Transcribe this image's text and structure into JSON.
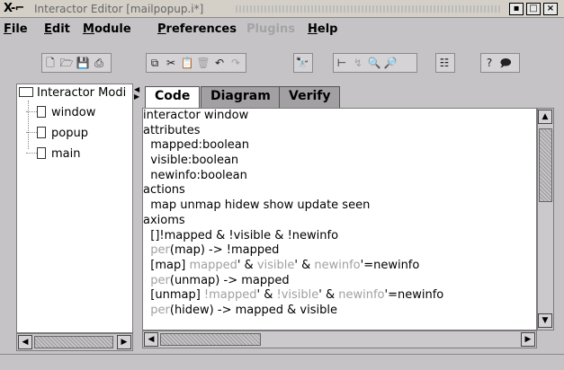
{
  "window": {
    "title": "Interactor Editor [mailpopup.i*]",
    "logo": "X-⌐"
  },
  "menu": [
    {
      "label": "File",
      "enabled": true
    },
    {
      "label": "Edit",
      "enabled": true
    },
    {
      "label": "Module",
      "enabled": true
    },
    {
      "label": "Preferences",
      "enabled": true
    },
    {
      "label": "Plugins",
      "enabled": false
    },
    {
      "label": "Help",
      "enabled": true
    }
  ],
  "tree": {
    "root": "Interactor Modi",
    "children": [
      "window",
      "popup",
      "main"
    ]
  },
  "tabs": [
    "Code",
    "Diagram",
    "Verify"
  ],
  "active_tab": "Code",
  "code": [
    [
      {
        "t": "interactor window"
      }
    ],
    [
      {
        "t": "attributes"
      }
    ],
    [
      {
        "t": "  mapped:boolean"
      }
    ],
    [
      {
        "t": "  visible:boolean"
      }
    ],
    [
      {
        "t": "  newinfo:boolean"
      }
    ],
    [
      {
        "t": "actions"
      }
    ],
    [
      {
        "t": "  map unmap hidew show update seen"
      }
    ],
    [
      {
        "t": "axioms"
      }
    ],
    [
      {
        "t": "  []!mapped & !visible & !newinfo"
      }
    ],
    [
      {
        "t": "  "
      },
      {
        "t": "per",
        "g": true
      },
      {
        "t": "(map) -> !mapped"
      }
    ],
    [
      {
        "t": "  [map] "
      },
      {
        "t": "mapped",
        "g": true
      },
      {
        "t": "' & "
      },
      {
        "t": "visible",
        "g": true
      },
      {
        "t": "' & "
      },
      {
        "t": "newinfo",
        "g": true
      },
      {
        "t": "'=newinfo"
      }
    ],
    [
      {
        "t": "  "
      },
      {
        "t": "per",
        "g": true
      },
      {
        "t": "(unmap) -> mapped"
      }
    ],
    [
      {
        "t": "  [unmap] "
      },
      {
        "t": "!mapped",
        "g": true
      },
      {
        "t": "' & "
      },
      {
        "t": "!visible",
        "g": true
      },
      {
        "t": "' & "
      },
      {
        "t": "newinfo",
        "g": true
      },
      {
        "t": "'=newinfo"
      }
    ],
    [
      {
        "t": "  "
      },
      {
        "t": "per",
        "g": true
      },
      {
        "t": "(hidew) -> mapped & visible"
      }
    ]
  ],
  "colors": {
    "background": "#c6c3c6",
    "editor": "#ffffff",
    "inactive_tab": "#a3a0a3",
    "keyword_gray": "#a0a0a0"
  }
}
